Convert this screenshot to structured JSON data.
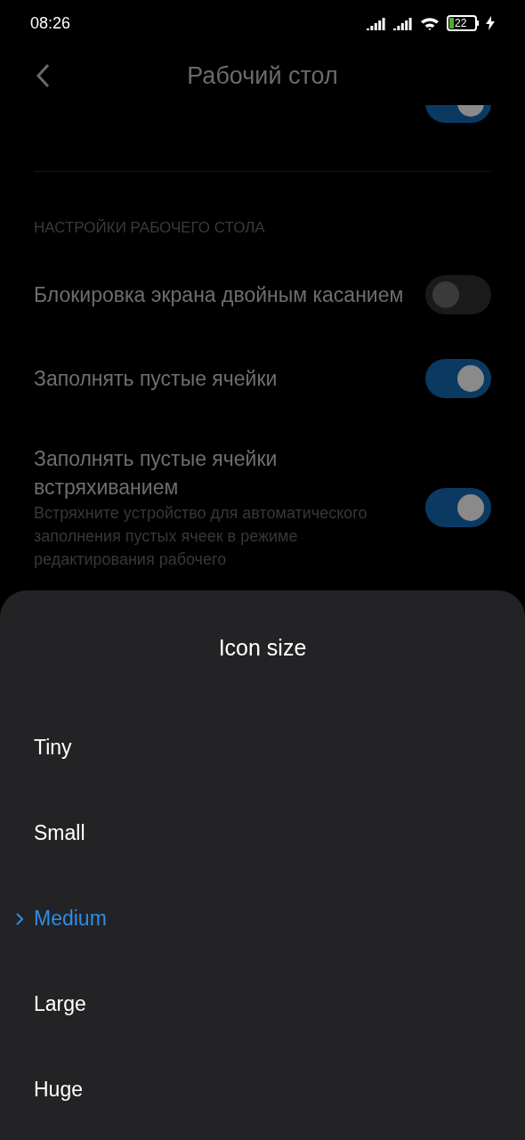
{
  "status_bar": {
    "time": "08:26",
    "battery": "22"
  },
  "header": {
    "title": "Рабочий стол"
  },
  "top_toggle": {
    "on": true
  },
  "section": {
    "title": "НАСТРОЙКИ РАБОЧЕГО СТОЛА",
    "rows": [
      {
        "label": "Блокировка экрана двойным касанием",
        "on": false
      },
      {
        "label": "Заполнять пустые ячейки",
        "on": true
      },
      {
        "label": "Заполнять пустые ячейки встряхиванием",
        "description": "Встряхните устройство для автоматического заполнения пустых ячеек в режиме редактирования рабочего",
        "on": true
      }
    ]
  },
  "sheet": {
    "title": "Icon size",
    "options": [
      {
        "label": "Tiny",
        "selected": false
      },
      {
        "label": "Small",
        "selected": false
      },
      {
        "label": "Medium",
        "selected": true
      },
      {
        "label": "Large",
        "selected": false
      },
      {
        "label": "Huge",
        "selected": false
      }
    ]
  }
}
